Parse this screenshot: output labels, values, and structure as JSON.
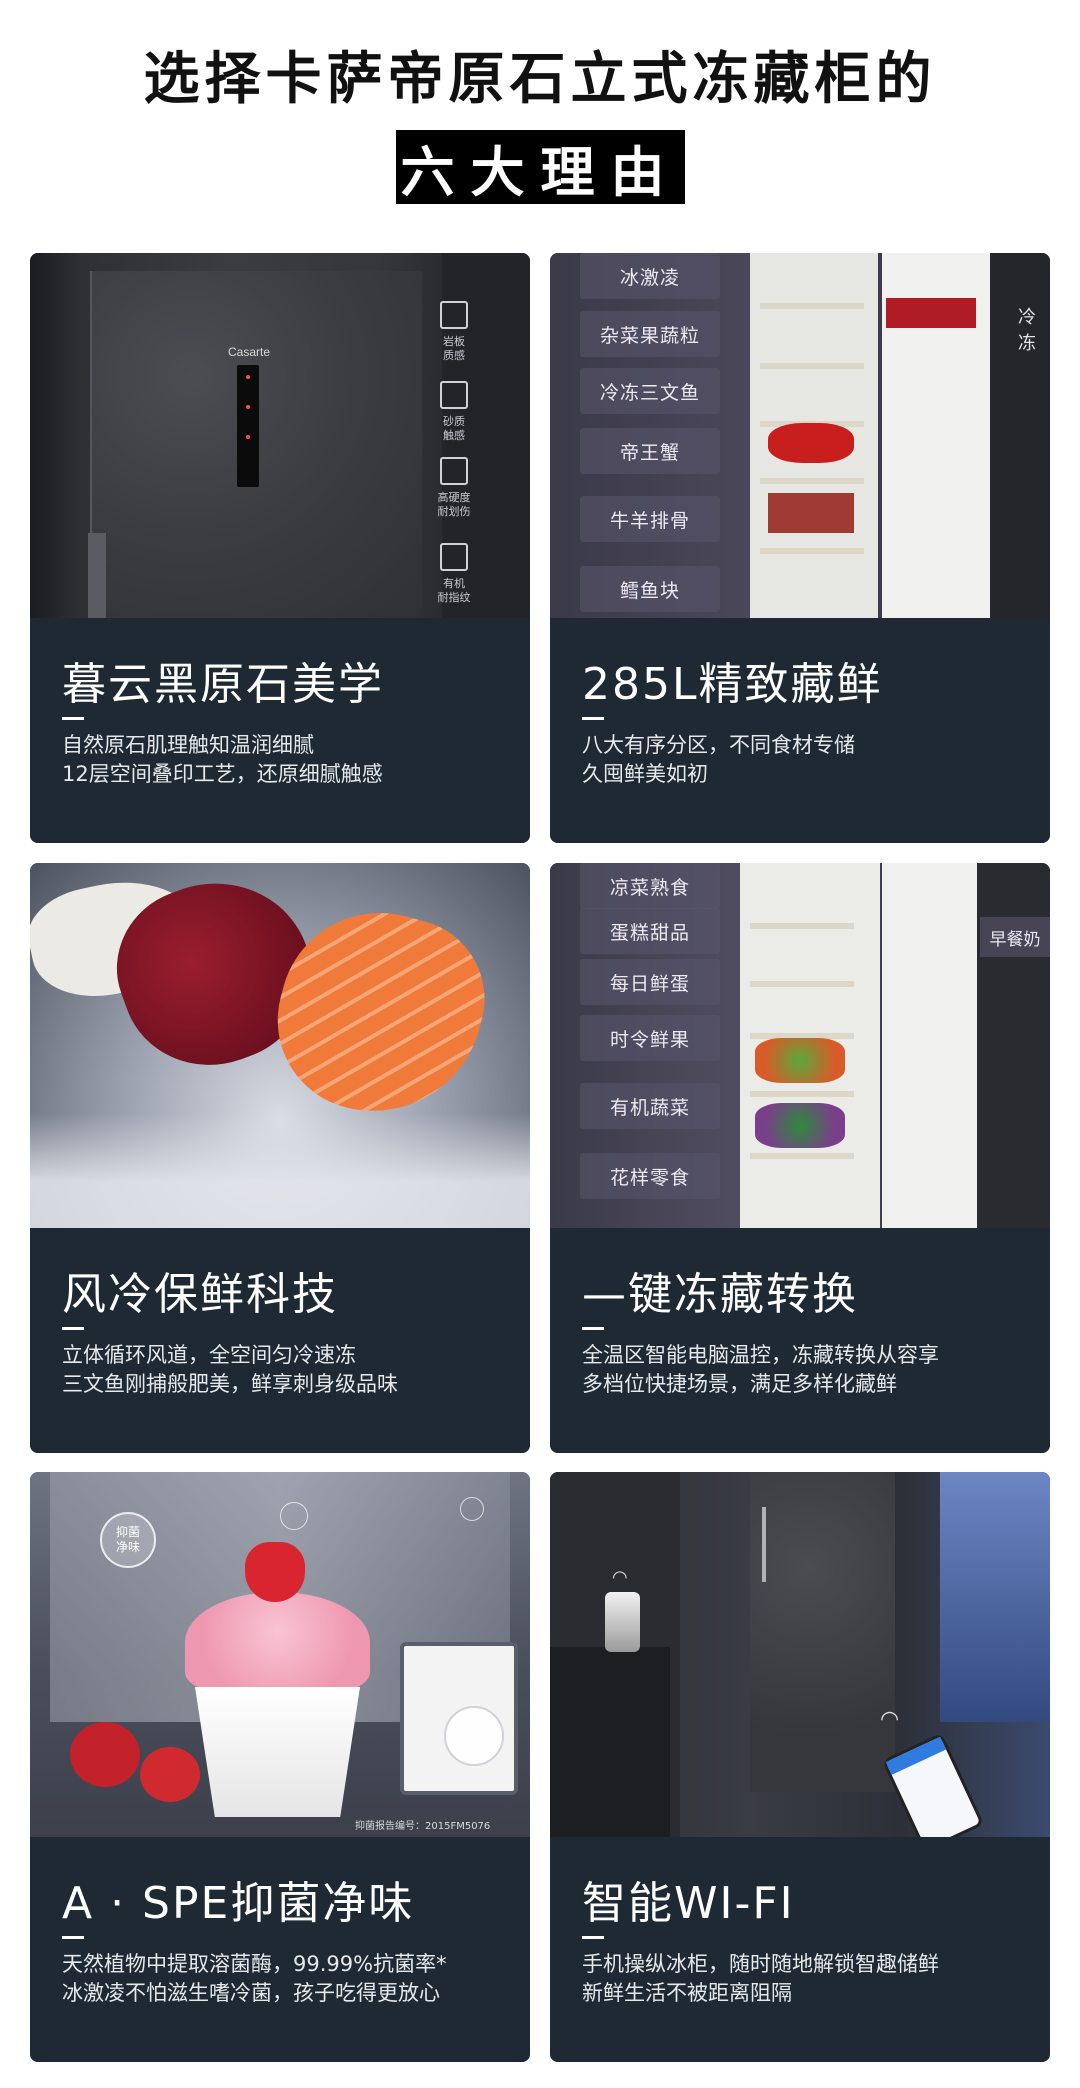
{
  "header": {
    "title_line1": "选择卡萨帝原石立式冻藏柜的",
    "title_line2": "六大理由"
  },
  "cards": [
    {
      "title": "暮云黑原石美学",
      "desc": [
        "自然原石肌理触知温润细腻",
        "12层空间叠印工艺，还原细腻触感"
      ],
      "brand": "Casarte",
      "features": [
        {
          "icon": "rock-icon",
          "label": "岩板\n质感"
        },
        {
          "icon": "sand-icon",
          "label": "砂质\n触感"
        },
        {
          "icon": "diamond-icon",
          "label": "高硬度\n耐划伤"
        },
        {
          "icon": "fingerprint-icon",
          "label": "有机\n耐指纹"
        }
      ]
    },
    {
      "title": "285L精致藏鲜",
      "desc": [
        "八大有序分区，不同食材专储",
        "久囤鲜美如初"
      ],
      "shelves": [
        "冰激凌",
        "杂菜果蔬粒",
        "冷冻三文鱼",
        "帝王蟹",
        "牛羊排骨",
        "鳕鱼块"
      ],
      "side_label": "冷冻"
    },
    {
      "title": "风冷保鲜科技",
      "desc": [
        "立体循环风道，全空间匀冷速冻",
        "三文鱼刚捕般肥美，鲜享刺身级品味"
      ]
    },
    {
      "title": "—键冻藏转换",
      "desc": [
        "全温区智能电脑温控，冻藏转换从容享",
        "多档位快捷场景，满足多样化藏鲜"
      ],
      "shelves": [
        "凉菜熟食",
        "蛋糕甜品",
        "每日鲜蛋",
        "时令鲜果",
        "有机蔬菜",
        "花样零食"
      ],
      "side_label": "早餐奶"
    },
    {
      "title": "A · SPE抑菌净味",
      "desc": [
        "天然植物中提取溶菌酶，99.99%抗菌率*",
        "冰激凌不怕滋生嗜冷菌，孩子吃得更放心"
      ],
      "bubble_label": "抑菌\n净味",
      "report_note": "抑菌报告编号：2015FM5076"
    },
    {
      "title": "智能WI-FI",
      "desc": [
        "手机操纵冰柜，随时随地解锁智趣储鲜",
        "新鲜生活不被距离阻隔"
      ]
    }
  ],
  "colors": {
    "card_text_bg": "#1f2933",
    "title_box": "#000000"
  }
}
